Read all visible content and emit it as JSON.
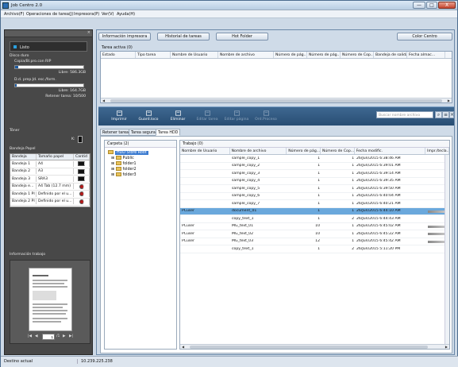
{
  "window": {
    "title": "Job Centro 2.0",
    "minimize": "—",
    "maximize": "□",
    "close": "X"
  },
  "menu": [
    "Archivo(F)",
    "Operaciones de tarea(J)",
    "Impresora(P)",
    "Ver(V)",
    "Ayuda(H)"
  ],
  "left": {
    "close_glyph": "×",
    "printer_name": "Listo",
    "disk_label": "Disco duro",
    "copy_label": "Copia/Bl.pro.con RIP",
    "free1": "Libre: 586.3GB",
    "free1_fill": 0.05,
    "job_label": "D.d. prep.Jd. esc./form.",
    "free2": "Libre: 164.7GB",
    "free2_fill": 0.02,
    "retain": "Retener tarea: 10/500",
    "toner_label": "Tóner",
    "toner_k": "K:",
    "tray_section": "Bandeja Papel",
    "tray_headers": [
      "Bandeja",
      "Tamaño papel",
      "Cantid"
    ],
    "trays": [
      {
        "name": "Bandeja 1",
        "size": "A4",
        "icon": "black"
      },
      {
        "name": "Bandeja 2",
        "size": "A3",
        "icon": "black"
      },
      {
        "name": "Bandeja 3",
        "size": "SRA3",
        "icon": "black"
      },
      {
        "name": "Bandeja e...",
        "size": "A4 Tab (12.7 mm)",
        "icon": "red"
      },
      {
        "name": "Bandeja 1 PI",
        "size": "Definido por el u...",
        "icon": "red"
      },
      {
        "name": "Bandeja 2 PI",
        "size": "Definido por el u...",
        "icon": "red"
      }
    ],
    "preview_label": "Información trabajo",
    "page_current": "1",
    "page_total": "/1"
  },
  "top_buttons": [
    "Información impresora",
    "Historial de tareas",
    "Hot Folder",
    "Color Centro"
  ],
  "active": {
    "label": "Tarea activa (0)",
    "headers": [
      "Estado",
      "Tipo tarea",
      "Nombre de Usuario",
      "Nombre de archivo",
      "Número de pág...",
      "Número de pág...",
      "Número de Cop...",
      "Bandeja de salida",
      "Fecha almac..."
    ]
  },
  "toolbar": [
    {
      "label": "Imprimir",
      "enabled": true
    },
    {
      "label": "Guard.loco",
      "enabled": true
    },
    {
      "label": "Eliminar",
      "enabled": true
    },
    {
      "label": "Editar tarea",
      "enabled": false
    },
    {
      "label": "Editar página",
      "enabled": false
    },
    {
      "label": "Ord.Proceso",
      "enabled": false
    }
  ],
  "search": {
    "placeholder": "Buscar nombre archivo"
  },
  "tabs": [
    "Retener tarea",
    "Tarea segura",
    "Tarea HDD"
  ],
  "folders": {
    "caption": "Carpeta (2)",
    "root": "HDD Store Root",
    "items": [
      "Public",
      "folder1",
      "folder2",
      "folder3"
    ]
  },
  "jobs": {
    "caption": "Trabajo (0)",
    "headers": [
      "Nombre de Usuario",
      "Nombre de archivo",
      "Número de pág...",
      "Número de Cop...",
      "Fecha modific.",
      "Impr./tecla..."
    ],
    "rows": [
      {
        "user": "",
        "file": "sample_copy_1",
        "pages": "1",
        "copies": "1",
        "date": "26/Jun/2015 6:38:46 AM"
      },
      {
        "user": "",
        "file": "sample_copy_2",
        "pages": "1",
        "copies": "1",
        "date": "26/Jun/2015 6:39:01 AM"
      },
      {
        "user": "",
        "file": "sample_copy_3",
        "pages": "1",
        "copies": "1",
        "date": "26/Jun/2015 6:39:14 AM"
      },
      {
        "user": "",
        "file": "sample_copy_4",
        "pages": "1",
        "copies": "1",
        "date": "26/Jun/2015 6:39:35 AM"
      },
      {
        "user": "",
        "file": "sample_copy_5",
        "pages": "1",
        "copies": "1",
        "date": "26/Jun/2015 6:39:50 AM"
      },
      {
        "user": "",
        "file": "sample_copy_6",
        "pages": "1",
        "copies": "1",
        "date": "26/Jun/2015 6:40:04 AM"
      },
      {
        "user": "",
        "file": "sample_copy_7",
        "pages": "1",
        "copies": "1",
        "date": "26/Jun/2015 6:40:21 AM"
      },
      {
        "user": "PCuser",
        "file": "document_01",
        "pages": "1",
        "copies": "1",
        "date": "26/Jun/2015 6:44:10 AM"
      },
      {
        "user": "",
        "file": "copy_text_1",
        "pages": "1",
        "copies": "2",
        "date": "26/Jun/2015 6:44:43 AM"
      },
      {
        "user": "PCuser",
        "file": "MG_text_01",
        "pages": "10",
        "copies": "1",
        "date": "26/Jun/2015 6:45:02 AM"
      },
      {
        "user": "PCuser",
        "file": "MG_text_02",
        "pages": "10",
        "copies": "1",
        "date": "26/Jun/2015 6:45:22 AM"
      },
      {
        "user": "PCuser",
        "file": "MG_text_03",
        "pages": "12",
        "copies": "1",
        "date": "26/Jun/2015 6:45:42 AM"
      },
      {
        "user": "",
        "file": "copy_text_1",
        "pages": "1",
        "copies": "2",
        "date": "26/Jun/2015 5:11:20 PM"
      }
    ]
  },
  "status": {
    "label": "Destino actual",
    "address": "10.239.225.238"
  }
}
